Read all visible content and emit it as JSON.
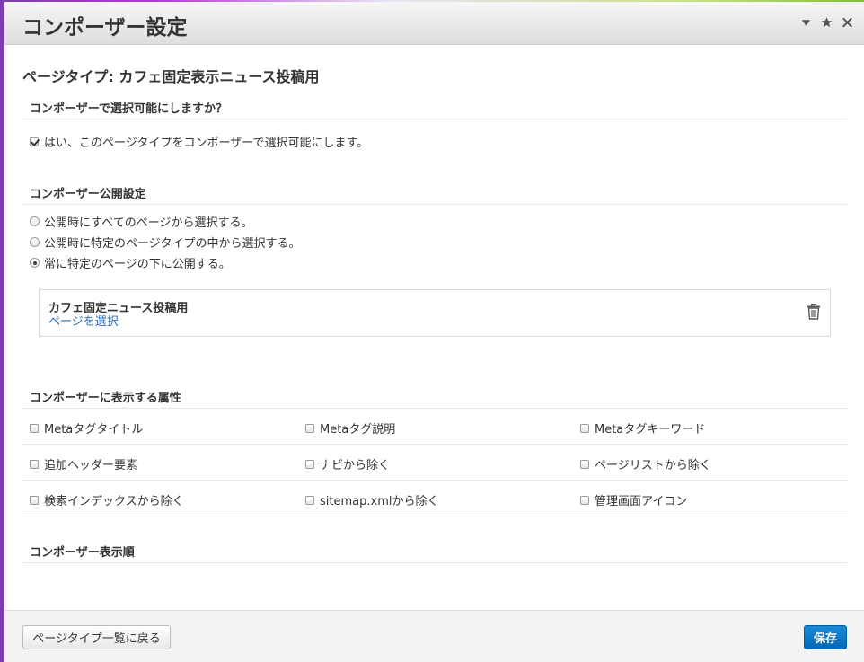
{
  "dialog": {
    "title": "コンポーザー設定"
  },
  "page_type_title": "ページタイプ: カフェ固定表示ニュース投稿用",
  "selectable": {
    "heading": "コンポーザーで選択可能にしますか？",
    "checkbox_label": "はい、このページタイプをコンポーザーで選択可能にします。",
    "checked": true
  },
  "publish": {
    "heading": "コンポーザー公開設定",
    "options": [
      {
        "label": "公開時にすべてのページから選択する。",
        "selected": false
      },
      {
        "label": "公開時に特定のページタイプの中から選択する。",
        "selected": false
      },
      {
        "label": "常に特定のページの下に公開する。",
        "selected": true
      }
    ],
    "target_page": {
      "title": "カフェ固定ニュース投稿用",
      "select_link": "ページを選択"
    }
  },
  "attributes": {
    "heading": "コンポーザーに表示する属性",
    "items": [
      {
        "label": "Metaタグタイトル",
        "checked": false
      },
      {
        "label": "Metaタグ説明",
        "checked": false
      },
      {
        "label": "Metaタグキーワード",
        "checked": false
      },
      {
        "label": "追加ヘッダー要素",
        "checked": false
      },
      {
        "label": "ナビから除く",
        "checked": false
      },
      {
        "label": "ページリストから除く",
        "checked": false
      },
      {
        "label": "検索インデックスから除く",
        "checked": false
      },
      {
        "label": "sitemap.xmlから除く",
        "checked": false
      },
      {
        "label": "管理画面アイコン",
        "checked": false
      }
    ]
  },
  "order": {
    "heading": "コンポーザー表示順"
  },
  "footer": {
    "back_label": "ページタイプ一覧に戻る",
    "save_label": "保存"
  },
  "colors": {
    "primary": "#0068b7",
    "link": "#2a6ebb"
  }
}
